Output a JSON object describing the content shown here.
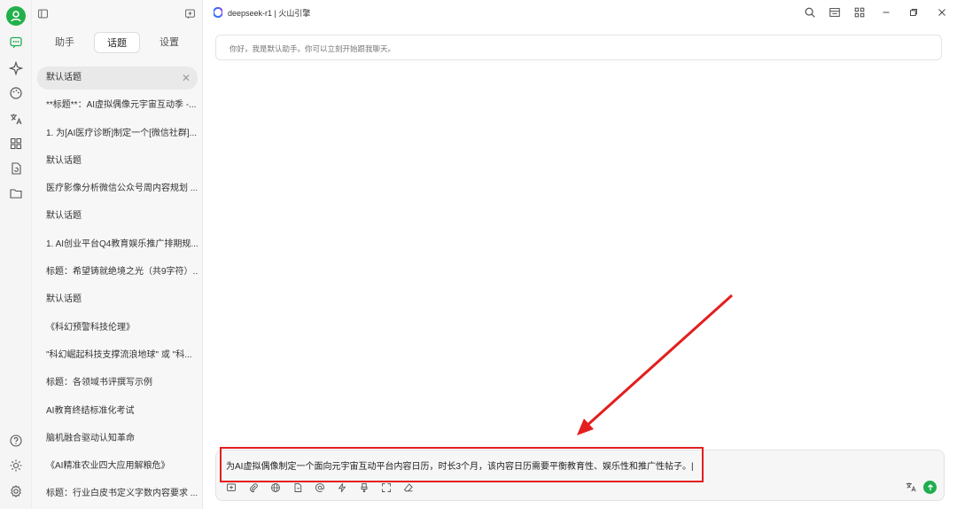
{
  "topics_panel": {
    "tabs": [
      "助手",
      "话题",
      "设置"
    ],
    "active_tab": "话题",
    "topics": [
      "默认话题",
      "**标题**：AI虚拟偶像元宇宙互动季 -...",
      "1. 为[AI医疗诊断]制定一个[微信社群]...",
      "默认话题",
      "医疗影像分析微信公众号周内容规划 ...",
      "默认话题",
      "1. AI创业平台Q4教育娱乐推广排期规...",
      "标题：希望铸就绝境之光（共9字符）...",
      "默认话题",
      "《科幻预警科技伦理》",
      "\"科幻崛起科技支撑流浪地球\" 或 \"科...",
      "标题：各领域书评撰写示例",
      "AI教育终结标准化考试",
      "脑机融合驱动认知革命",
      "《AI精准农业四大应用解粮危》",
      "标题：行业白皮书定义字数内容要求 ..."
    ]
  },
  "main": {
    "title": "deepseek-r1 | 火山引擎",
    "assistant_greeting": "你好，我是默认助手。你可以立刻开始跟我聊天。",
    "composer_text": "为AI虚拟偶像制定一个面向元宇宙互动平台内容日历，时长3个月，该内容日历需要平衡教育性、娱乐性和推广性帖子。|"
  },
  "colors": {
    "accent_green": "#1fae4f",
    "highlight_red": "#e31e1e"
  }
}
